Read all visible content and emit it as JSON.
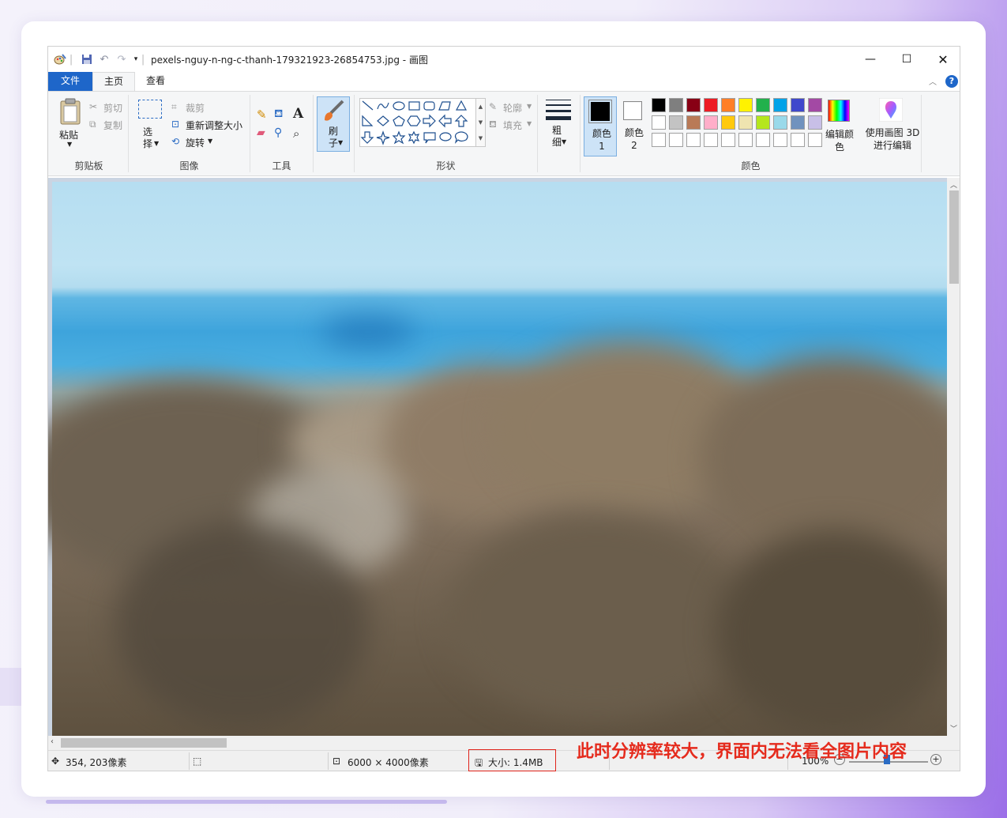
{
  "window": {
    "title": "pexels-nguy-n-ng-c-thanh-179321923-26854753.jpg - 画图"
  },
  "tabs": {
    "file": "文件",
    "home": "主页",
    "view": "查看"
  },
  "ribbon": {
    "clipboard": {
      "paste": "粘贴",
      "cut": "剪切",
      "copy": "复制",
      "label": "剪贴板"
    },
    "image": {
      "select": "选择",
      "crop": "裁剪",
      "resize": "重新调整大小",
      "rotate": "旋转",
      "label": "图像"
    },
    "tools": {
      "label": "工具"
    },
    "brush": {
      "label": "刷子"
    },
    "shapes": {
      "outline": "轮廓",
      "fill": "填充",
      "label": "形状"
    },
    "size": {
      "label": "粗细"
    },
    "colors": {
      "color1": "颜色 1",
      "color2": "颜色 2",
      "edit": "编辑颜色",
      "label": "颜色",
      "color1_value": "#000000",
      "color2_value": "#ffffff",
      "palette": [
        "#000000",
        "#7f7f7f",
        "#880015",
        "#ed1c24",
        "#ff7f27",
        "#fff200",
        "#22b14c",
        "#00a2e8",
        "#3f48cc",
        "#a349a4",
        "#ffffff",
        "#c3c3c3",
        "#b97a57",
        "#ffaec9",
        "#ffc90e",
        "#efe4b0",
        "#b5e61d",
        "#99d9ea",
        "#7092be",
        "#c8bfe7"
      ]
    },
    "paint3d": {
      "label": "使用画图 3D 进行编辑"
    }
  },
  "status": {
    "cursor_pos": "354, 203像素",
    "dimensions": "6000 × 4000像素",
    "file_size": "大小: 1.4MB",
    "zoom": "100%"
  },
  "annotation": "此时分辨率较大，界面内无法看全图片内容"
}
